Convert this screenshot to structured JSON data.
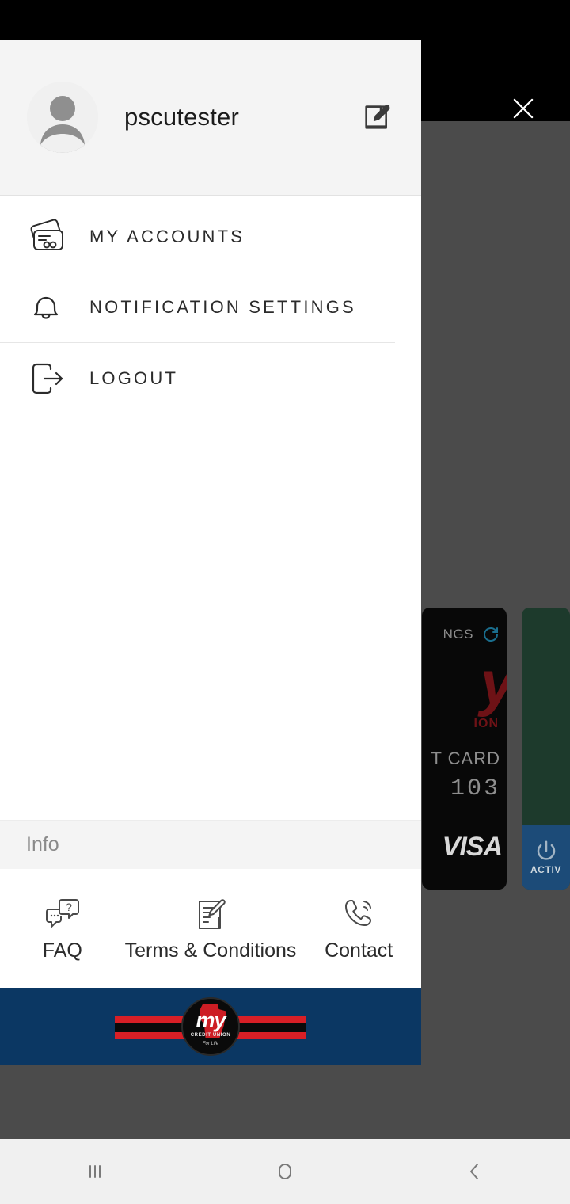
{
  "close_button": {
    "icon": "close-icon"
  },
  "drawer": {
    "profile": {
      "name": "pscutester",
      "avatar_icon": "avatar-person-icon",
      "edit_icon": "edit-icon"
    },
    "menu_items": [
      {
        "label": "MY ACCOUNTS",
        "icon": "credit-cards-icon"
      },
      {
        "label": "NOTIFICATION SETTINGS",
        "icon": "bell-icon"
      },
      {
        "label": "LOGOUT",
        "icon": "logout-icon"
      }
    ],
    "info_section": {
      "header": "Info",
      "items": [
        {
          "label": "FAQ",
          "icon": "faq-speech-bubbles-icon"
        },
        {
          "label": "Terms & Conditions",
          "icon": "document-pencil-icon"
        },
        {
          "label": "Contact",
          "icon": "phone-icon"
        }
      ]
    },
    "brand_footer": {
      "logo_text": "my",
      "logo_subtext": "CREDIT UNION",
      "logo_tagline": "For Life",
      "background_color": "#0b3763",
      "stripe_red": "#d81f26",
      "stripe_black": "#0a0a0a"
    }
  },
  "background_app": {
    "visa_card": {
      "savings_label": "NGS",
      "refresh_icon": "refresh-icon",
      "brand_logo_text": "y",
      "brand_sub_text": "ION",
      "card_type": "T CARD",
      "card_number": "103",
      "network": "VISA"
    },
    "green_card": {
      "activate_label": "ACTIV",
      "power_icon": "power-icon",
      "card_color": "#1d3a2c",
      "activate_color": "#1c4b78"
    }
  },
  "nav_bar": {
    "buttons": [
      {
        "name": "recents",
        "icon": "recents-icon"
      },
      {
        "name": "home",
        "icon": "home-icon"
      },
      {
        "name": "back",
        "icon": "back-icon"
      }
    ]
  }
}
